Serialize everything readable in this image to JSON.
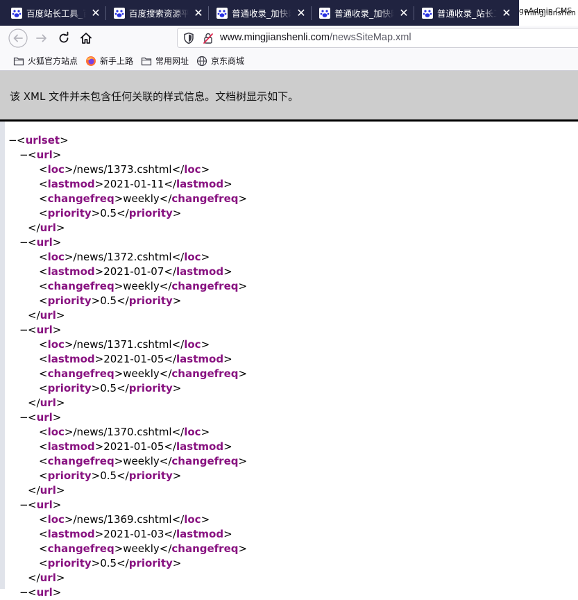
{
  "tabs": [
    {
      "title": "百度站长工具_百度",
      "icon": "baidu-paw-icon"
    },
    {
      "title": "百度搜索资源平台",
      "icon": "baidu-paw-icon"
    },
    {
      "title": "普通收录_加快网站",
      "icon": "baidu-paw-icon"
    },
    {
      "title": "普通收录_加快网站",
      "icon": "baidu-paw-icon"
    },
    {
      "title": "普通收录_站长工具",
      "icon": "baidu-paw-icon"
    }
  ],
  "active_tab": {
    "line1": "PageAdmin CMS",
    "line2": "mingjianshen"
  },
  "close_glyph": "✕",
  "toolbar": {
    "url_host": "www.mingjianshenli.com",
    "url_path": "/newsSiteMap.xml"
  },
  "bookmarks": [
    {
      "label": "火狐官方站点",
      "icon": "folder-icon"
    },
    {
      "label": "新手上路",
      "icon": "firefox-icon"
    },
    {
      "label": "常用网址",
      "icon": "folder-icon"
    },
    {
      "label": "京东商城",
      "icon": "globe-icon"
    }
  ],
  "xml_notice": "该 XML 文件并未包含任何关联的样式信息。文档树显示如下。",
  "xml": {
    "root": "urlset",
    "fold_glyph": "−",
    "lt": "<",
    "gt": ">",
    "close_lt": "</",
    "child": "url",
    "fields": [
      "loc",
      "lastmod",
      "changefreq",
      "priority"
    ],
    "entries": [
      {
        "loc": "/news/1373.cshtml",
        "lastmod": "2021-01-11",
        "changefreq": "weekly",
        "priority": "0.5"
      },
      {
        "loc": "/news/1372.cshtml",
        "lastmod": "2021-01-07",
        "changefreq": "weekly",
        "priority": "0.5"
      },
      {
        "loc": "/news/1371.cshtml",
        "lastmod": "2021-01-05",
        "changefreq": "weekly",
        "priority": "0.5"
      },
      {
        "loc": "/news/1370.cshtml",
        "lastmod": "2021-01-05",
        "changefreq": "weekly",
        "priority": "0.5"
      },
      {
        "loc": "/news/1369.cshtml",
        "lastmod": "2021-01-03",
        "changefreq": "weekly",
        "priority": "0.5"
      }
    ]
  },
  "colors": {
    "tag": "#881280",
    "tabstrip": "#202340",
    "xml_header": "#cdcdcd"
  }
}
